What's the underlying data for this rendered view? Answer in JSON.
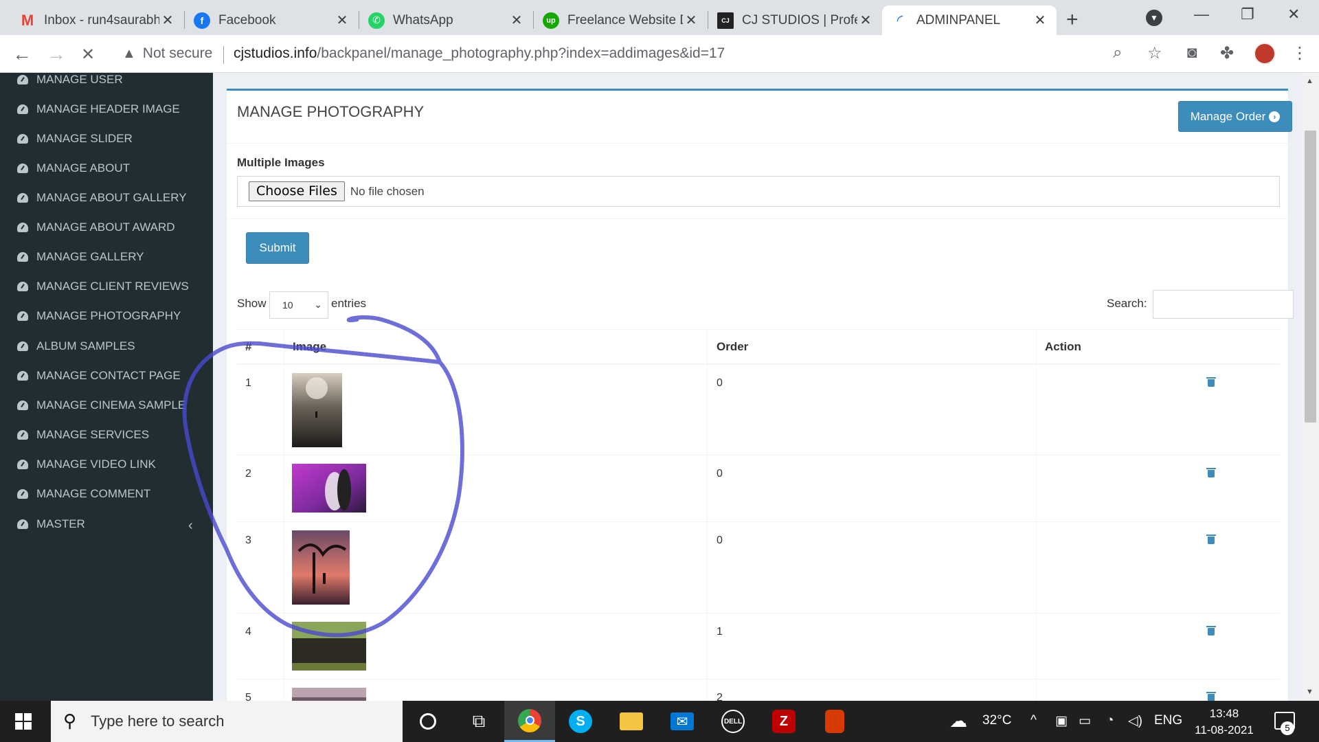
{
  "browser": {
    "tabs": [
      {
        "title": "Inbox - run4saurabh",
        "icon": "gmail-icon",
        "color": "#ea4335",
        "glyph": "M"
      },
      {
        "title": "Facebook",
        "icon": "facebook-icon",
        "color": "#1877f2",
        "glyph": "f"
      },
      {
        "title": "WhatsApp",
        "icon": "whatsapp-icon",
        "color": "#25d366",
        "glyph": "w"
      },
      {
        "title": "Freelance Website D",
        "icon": "upwork-icon",
        "color": "#14a800",
        "glyph": "up"
      },
      {
        "title": "CJ STUDIOS | Profes",
        "icon": "cjstudios-icon",
        "color": "#222222",
        "glyph": "CJ"
      },
      {
        "title": "ADMINPANEL",
        "icon": "loading-spinner-icon",
        "color": "#1a73e8",
        "glyph": "◜"
      }
    ],
    "security_label": "Not secure",
    "url_host": "cjstudios.info",
    "url_path": "/backpanel/manage_photography.php?index=addimages&id=17"
  },
  "sidebar": {
    "items": [
      {
        "label": "MANAGE USER"
      },
      {
        "label": "MANAGE HEADER IMAGE"
      },
      {
        "label": "MANAGE SLIDER"
      },
      {
        "label": "MANAGE ABOUT"
      },
      {
        "label": "MANAGE ABOUT GALLERY"
      },
      {
        "label": "MANAGE ABOUT AWARD"
      },
      {
        "label": "MANAGE GALLERY"
      },
      {
        "label": "MANAGE CLIENT REVIEWS"
      },
      {
        "label": "MANAGE PHOTOGRAPHY"
      },
      {
        "label": "ALBUM SAMPLES"
      },
      {
        "label": "MANAGE CONTACT PAGE"
      },
      {
        "label": "MANAGE CINEMA SAMPLE"
      },
      {
        "label": "MANAGE SERVICES"
      },
      {
        "label": "MANAGE VIDEO LINK"
      },
      {
        "label": "MANAGE COMMENT"
      },
      {
        "label": "MASTER"
      }
    ]
  },
  "main": {
    "title": "MANAGE PHOTOGRAPHY",
    "manage_order_label": "Manage Order",
    "multiple_images_label": "Multiple Images",
    "choose_files_label": "Choose Files",
    "no_file_label": "No file chosen",
    "submit_label": "Submit",
    "show_label": "Show",
    "page_size": "10",
    "entries_label": "entries",
    "search_label": "Search:",
    "search_value": "",
    "columns": [
      "#",
      "Image",
      "Order",
      "Action"
    ],
    "rows": [
      {
        "num": "1",
        "order": "0"
      },
      {
        "num": "2",
        "order": "0"
      },
      {
        "num": "3",
        "order": "0"
      },
      {
        "num": "4",
        "order": "1"
      },
      {
        "num": "5",
        "order": "2"
      }
    ]
  },
  "taskbar": {
    "search_placeholder": "Type here to search",
    "weather_temp": "32°C",
    "language": "ENG",
    "time": "13:48",
    "date": "11-08-2021",
    "notification_count": "5"
  },
  "colors": {
    "sidebar_bg": "#222d32",
    "primary": "#3c8dbc",
    "scribble": "#4a4ad0"
  }
}
